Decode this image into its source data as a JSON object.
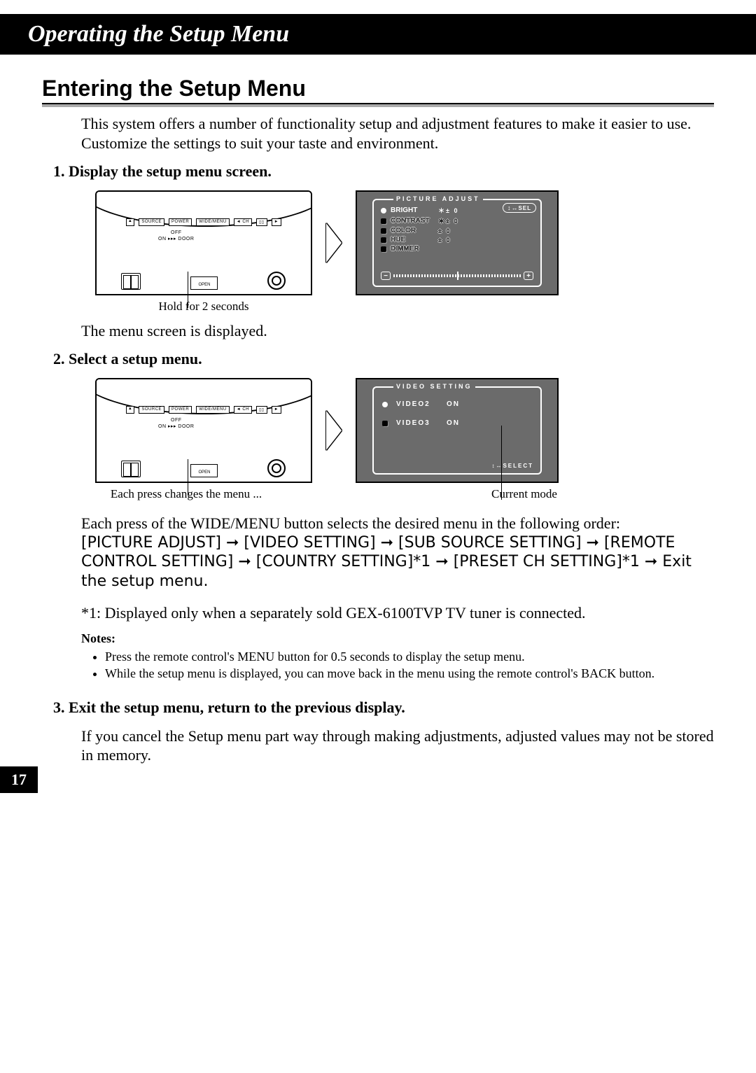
{
  "chapter_title": "Operating the Setup Menu",
  "section_title": "Entering the Setup Menu",
  "intro": "This system offers a number of functionality setup and adjustment features to make it easier to use. Customize the settings to suit your taste and environment.",
  "step1": {
    "heading": "1. Display the setup menu screen.",
    "caption": "Hold for 2 seconds",
    "result_text": "The menu screen is displayed.",
    "osd_title": "PICTURE ADJUST",
    "sel_pill_arrows": "↕↔",
    "sel_pill_label": "SEL",
    "rows": [
      {
        "label": "BRIGHT",
        "value": "＊± 0",
        "selected": true
      },
      {
        "label": "CONTRAST",
        "value": "＊± 0",
        "selected": false
      },
      {
        "label": "COLOR",
        "value": "± 0",
        "selected": false
      },
      {
        "label": "HUE",
        "value": "± 0",
        "selected": false
      },
      {
        "label": "DIMMER",
        "value": "",
        "selected": false
      }
    ],
    "slider_minus": "−",
    "slider_plus": "+"
  },
  "step2": {
    "heading": "2. Select a setup menu.",
    "caption_left": "Each press changes the menu ...",
    "caption_right": "Current mode",
    "osd_title": "VIDEO SETTING",
    "rows": [
      {
        "label": "VIDEO2",
        "value": "ON",
        "selected": true
      },
      {
        "label": "VIDEO3",
        "value": "ON",
        "selected": false
      }
    ],
    "footer_arrows": "↕↔",
    "footer_label": "SELECT"
  },
  "explain1a": "Each press of the WIDE/MENU button selects the desired menu in the following order:",
  "sequence": "[PICTURE ADJUST] ➞ [VIDEO SETTING] ➞ [SUB SOURCE SETTING] ➞ [REMOTE CONTROL SETTING] ➞ [COUNTRY SETTING]*1 ➞ [PRESET CH SETTING]*1 ➞ Exit the setup menu.",
  "footnote1": "*1: Displayed only when a separately sold GEX-6100TVP TV tuner is connected.",
  "notes_head": "Notes:",
  "notes": [
    "Press the remote control's MENU button for 0.5 seconds to display the setup menu.",
    "While the setup menu is displayed, you can move back in the menu using the remote control's BACK button."
  ],
  "step3": {
    "heading": "3. Exit the setup menu, return to the previous display.",
    "body": "If you cancel the Setup menu part way through making adjustments, adjusted values may not be stored in memory."
  },
  "device_labels": {
    "source": "SOURCE",
    "power": "POWER",
    "widemenu": "WIDE/MENU",
    "ch_left": "◄ CH",
    "ch_right": "►",
    "pair": "▯▯",
    "off": "OFF",
    "on_door": "ON ▸▸▸ DOOR",
    "open": "OPEN",
    "up": "▲"
  },
  "page_number": "17"
}
